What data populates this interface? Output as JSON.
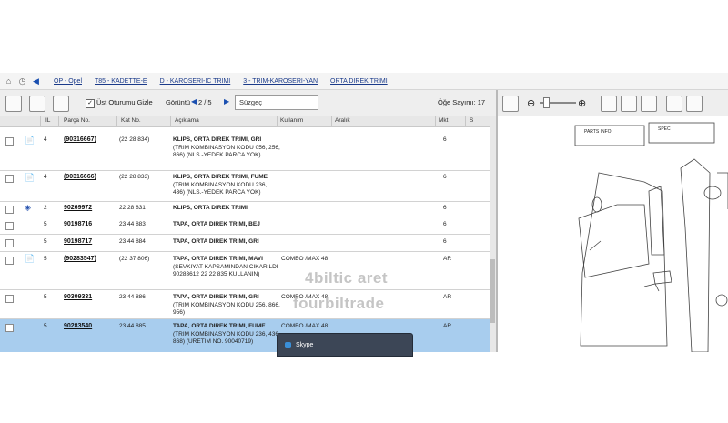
{
  "breadcrumb": {
    "items": [
      "OP - Opel",
      "T85 - KADETTE-E",
      "D - KAROSERI-IC TRIMI",
      "3 - TRIM-KAROSERI-YAN",
      "ORTA DIREK TRIMI"
    ]
  },
  "toolbar": {
    "hide_label": "Üst Oturumu Gizle",
    "view_label": "Görüntü",
    "page_indicator": "2 / 5",
    "filter_placeholder": "Süzgeç",
    "item_count": "Öğe Sayımı: 17"
  },
  "table": {
    "headers": [
      "IL",
      "Parça No.",
      "Kat No.",
      "Açıklama",
      "Kullanım",
      "Aralık",
      "Mkt",
      "S"
    ],
    "rows": [
      {
        "il": "4",
        "part": "(90316667)",
        "cat": "(22 28 834)",
        "desc": "KLIPS, ORTA DIREK TRIMI, GRI",
        "desc2": "(TRIM KOMBINASYON KODU 056, 256, 866) (NLS.-YEDEK PARCA YOK)",
        "usage": "",
        "qty": "6"
      },
      {
        "il": "4",
        "part": "(90316666)",
        "cat": "(22 28 833)",
        "desc": "KLIPS, ORTA DIREK TRIMI, FUME",
        "desc2": "(TRIM KOMBINASYON KODU 236, 436) (NLS.-YEDEK PARCA YOK)",
        "usage": "",
        "qty": "6"
      },
      {
        "il": "2",
        "part": "90269972",
        "cat": "22 28 831",
        "desc": "KLIPS, ORTA DIREK TRIMI",
        "desc2": "",
        "usage": "",
        "qty": "6"
      },
      {
        "il": "5",
        "part": "90198716",
        "cat": "23 44 883",
        "desc": "TAPA, ORTA DIREK TRIMI, BEJ",
        "desc2": "",
        "usage": "",
        "qty": "6"
      },
      {
        "il": "5",
        "part": "90198717",
        "cat": "23 44 884",
        "desc": "TAPA, ORTA DIREK TRIMI, GRI",
        "desc2": "",
        "usage": "",
        "qty": "6"
      },
      {
        "il": "5",
        "part": "(90283547)",
        "cat": "(22 37 806)",
        "desc": "TAPA, ORTA DIREK TRIMI, MAVI",
        "desc2": "(SEVKIYAT KAPSAMINDAN CIKARILDI-90283612 22 22 835 KULLANIN)",
        "usage": "COMBO /MAX 48",
        "qty": "AR"
      },
      {
        "il": "5",
        "part": "90309331",
        "cat": "23 44 886",
        "desc": "TAPA, ORTA DIREK TRIMI, GRI",
        "desc2": "(TRIM KOMBINASYON KODU 256, 866, 956)",
        "usage": "COMBO /MAX 48",
        "qty": "AR"
      },
      {
        "il": "5",
        "part": "90283540",
        "cat": "23 44 885",
        "desc": "TAPA, ORTA DIREK TRIMI, FUME",
        "desc2": "(TRIM KOMBINASYON KODU 236, 436, 868) (URETIM NO. 90040719)",
        "usage": "COMBO /MAX 48",
        "qty": "AR"
      }
    ]
  },
  "watermark": {
    "line1": "4biltic aret",
    "line2": "fourbiltrade"
  },
  "popup": {
    "label": "Skype"
  }
}
